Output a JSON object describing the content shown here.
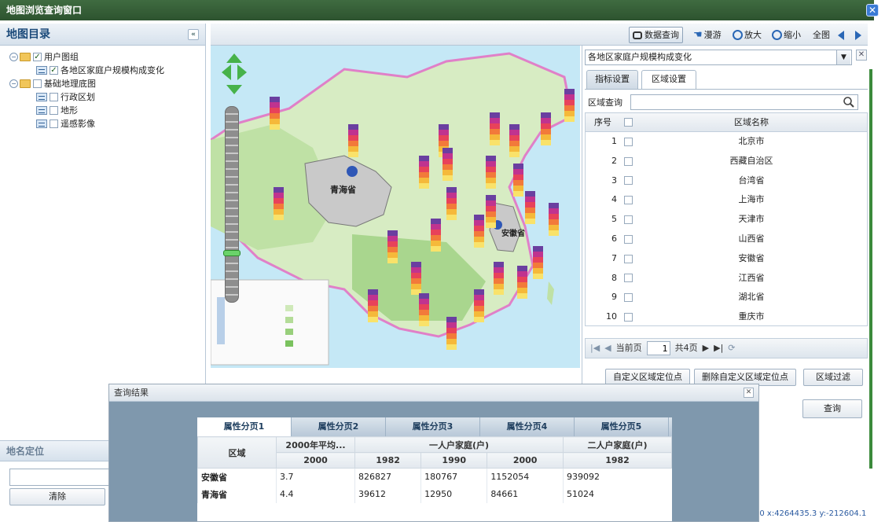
{
  "window": {
    "title": "地图浏览查询窗口"
  },
  "catalog": {
    "title": "地图目录",
    "items": [
      {
        "label": "用户图组",
        "checked": true,
        "level": 0
      },
      {
        "label": "各地区家庭户规模构成变化",
        "checked": true,
        "level": 1
      },
      {
        "label": "基础地理底图",
        "checked": false,
        "level": 0
      },
      {
        "label": "行政区划",
        "checked": false,
        "level": 1
      },
      {
        "label": "地形",
        "checked": false,
        "level": 1
      },
      {
        "label": "遥感影像",
        "checked": false,
        "level": 1
      }
    ]
  },
  "place": {
    "title": "地名定位",
    "input_value": "",
    "clear_label": "清除"
  },
  "toolbar": {
    "query_label": "数据查询",
    "pan_label": "漫游",
    "zoom_in_label": "放大",
    "zoom_out_label": "缩小",
    "full_label": "全图"
  },
  "map": {
    "labels": [
      "青海省",
      "安徽省"
    ]
  },
  "right": {
    "layer_select": "各地区家庭户规模构成变化",
    "tabs": [
      "指标设置",
      "区域设置"
    ],
    "active_tab": 1,
    "search_label": "区域查询",
    "grid": {
      "col_no": "序号",
      "col_name": "区域名称",
      "rows": [
        {
          "no": "1",
          "name": "北京市"
        },
        {
          "no": "2",
          "name": "西藏自治区"
        },
        {
          "no": "3",
          "name": "台湾省"
        },
        {
          "no": "4",
          "name": "上海市"
        },
        {
          "no": "5",
          "name": "天津市"
        },
        {
          "no": "6",
          "name": "山西省"
        },
        {
          "no": "7",
          "name": "安徽省"
        },
        {
          "no": "8",
          "name": "江西省"
        },
        {
          "no": "9",
          "name": "湖北省"
        },
        {
          "no": "10",
          "name": "重庆市"
        }
      ]
    },
    "pager": {
      "current_label": "当前页",
      "page": "1",
      "total": "共4页"
    },
    "buttons": {
      "custom_locate": "自定义区域定位点",
      "delete_locate": "删除自定义区域定位点",
      "filter": "区域过滤",
      "query": "查询"
    }
  },
  "coords": "00  x:4264435.3  y:-212604.1",
  "results": {
    "title": "查询结果",
    "tabs": [
      "属性分页1",
      "属性分页2",
      "属性分页3",
      "属性分页4",
      "属性分页5"
    ],
    "region_header": "区域",
    "group1": "2000年平均...",
    "group2": "一人户家庭(户)",
    "group3": "二人户家庭(户)",
    "years": [
      "2000",
      "1982",
      "1990",
      "2000",
      "1982"
    ],
    "rows": [
      {
        "region": "安徽省",
        "values": [
          "3.7",
          "826827",
          "180767",
          "1152054",
          "939092"
        ]
      },
      {
        "region": "青海省",
        "values": [
          "4.4",
          "39612",
          "12950",
          "84661",
          "51024"
        ]
      }
    ]
  }
}
